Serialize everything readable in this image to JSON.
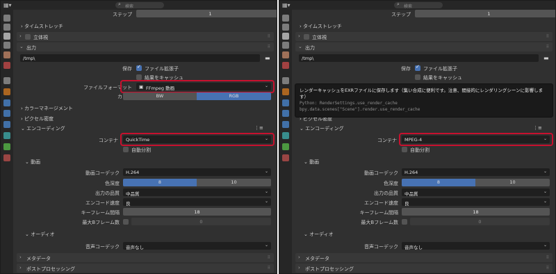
{
  "search_placeholder": "検索",
  "colors": {
    "accent": "#4772b3",
    "highlight": "#c8102e"
  },
  "tab_colors": [
    "#9a9a9a",
    "#9a9a9a",
    "#cfcfcf",
    "#9a9a9a",
    "#c88a6a",
    "#cc4b4b",
    "#9a9a9a",
    "#d87b1f",
    "#4b8ad4",
    "#4b8ad4",
    "#4b8ad4",
    "#3fb0b0",
    "#5abf4a",
    "#c0504d"
  ],
  "left": {
    "step_label": "ステップ",
    "step_value": "1",
    "timestretch": "タイムストレッチ",
    "stereo": "立体視",
    "output": "出力",
    "path": "/tmp\\",
    "save_label": "保存",
    "file_ext": "ファイル拡張子",
    "cache_result": "結果をキャッシュ",
    "fileformat_label": "ファイルフォーマット",
    "fileformat_value": "FFmpeg 動画",
    "color_label": "カラー",
    "color_bw": "BW",
    "color_rgb": "RGB",
    "color_mgmt": "カラーマネージメント",
    "pixel_density": "ピクセル密度",
    "encoding": "エンコーディング",
    "container_label": "コンテナ",
    "container_value": "QuickTime",
    "autosplit": "自動分割",
    "video": "動画",
    "codec_label": "動画コーデック",
    "codec_value": "H.264",
    "color_depth_label": "色深度",
    "depth8": "8",
    "depth10": "10",
    "quality_label": "出力の品質",
    "quality_value": "中品質",
    "speed_label": "エンコード速度",
    "speed_value": "良",
    "keyframe_label": "キーフレーム間隔",
    "keyframe_value": "18",
    "maxb_label": "最大Bフレーム数",
    "maxb_value": "0",
    "audio": "オーディオ",
    "audio_codec_label": "音声コーデック",
    "audio_codec_value": "音声なし",
    "metadata": "メタデータ",
    "postprocess": "ポストプロセッシング"
  },
  "right": {
    "step_label": "ステップ",
    "step_value": "1",
    "timestretch": "タイムストレッチ",
    "stereo": "立体視",
    "output": "出力",
    "path": "/tmp\\",
    "save_label": "保存",
    "file_ext": "ファイル拡張子",
    "cache_result": "結果をキャッシュ",
    "tooltip_line1": "レンダーキャッシュをEXRファイルに保存します（集い合成に便利です。注意、間接的にレンダリングシーンに影響します）",
    "tooltip_py1": "Python: RenderSettings.use_render_cache",
    "tooltip_py2": "bpy.data.scenes[\"Scene\"].render.use_render_cache",
    "pixel_density": "ピクセル密度",
    "encoding": "エンコーディング",
    "container_label": "コンテナ",
    "container_value": "MPEG-4",
    "autosplit": "自動分割",
    "video": "動画",
    "codec_label": "動画コーデック",
    "codec_value": "H.264",
    "color_depth_label": "色深度",
    "depth8": "8",
    "depth10": "10",
    "quality_label": "出力の品質",
    "quality_value": "中品質",
    "speed_label": "エンコード速度",
    "speed_value": "良",
    "keyframe_label": "キーフレーム間隔",
    "keyframe_value": "18",
    "maxb_label": "最大Bフレーム数",
    "maxb_value": "0",
    "audio": "オーディオ",
    "audio_codec_label": "音声コーデック",
    "audio_codec_value": "音声なし",
    "metadata": "メタデータ",
    "postprocess": "ポストプロセッシング"
  }
}
